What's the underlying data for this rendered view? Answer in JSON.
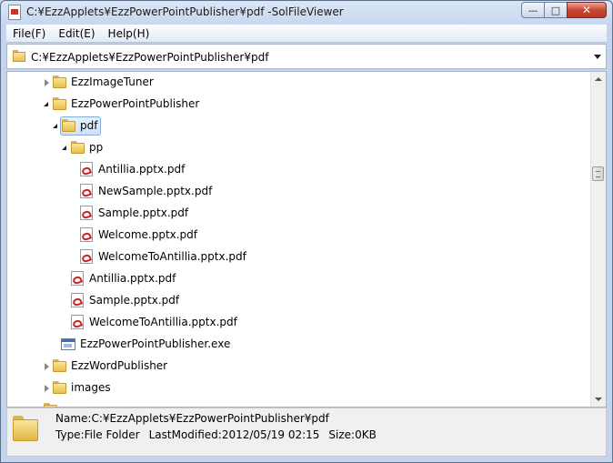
{
  "window": {
    "title": "C:¥EzzApplets¥EzzPowerPointPublisher¥pdf -SolFileViewer"
  },
  "caption_buttons": {
    "minimize": "—",
    "maximize": "□",
    "close": "✕"
  },
  "menu": {
    "file": "File(F)",
    "edit": "Edit(E)",
    "help": "Help(H)"
  },
  "path_bar": {
    "value": "C:¥EzzApplets¥EzzPowerPointPublisher¥pdf"
  },
  "tree": {
    "items": [
      {
        "label": "EzzImageTuner",
        "type": "folder",
        "state": "collapsed"
      },
      {
        "label": "EzzPowerPointPublisher",
        "type": "folder",
        "state": "expanded"
      },
      {
        "label": "pdf",
        "type": "folder",
        "state": "expanded",
        "selected": true
      },
      {
        "label": "pp",
        "type": "folder",
        "state": "expanded"
      },
      {
        "label": "Antillia.pptx.pdf",
        "type": "pdf"
      },
      {
        "label": "NewSample.pptx.pdf",
        "type": "pdf"
      },
      {
        "label": "Sample.pptx.pdf",
        "type": "pdf"
      },
      {
        "label": "Welcome.pptx.pdf",
        "type": "pdf"
      },
      {
        "label": "WelcomeToAntillia.pptx.pdf",
        "type": "pdf"
      },
      {
        "label": "Antillia.pptx.pdf",
        "type": "pdf"
      },
      {
        "label": "Sample.pptx.pdf",
        "type": "pdf"
      },
      {
        "label": "WelcomeToAntillia.pptx.pdf",
        "type": "pdf"
      },
      {
        "label": "EzzPowerPointPublisher.exe",
        "type": "exe"
      },
      {
        "label": "EzzWordPublisher",
        "type": "folder",
        "state": "collapsed"
      },
      {
        "label": "images",
        "type": "folder",
        "state": "collapsed"
      }
    ]
  },
  "status": {
    "name_label": "Name:",
    "name_value": "C:¥EzzApplets¥EzzPowerPointPublisher¥pdf",
    "type_label": "Type:",
    "type_value": "File Folder",
    "modified_label": "LastModified:",
    "modified_value": "2012/05/19 02:15",
    "size_label": "Size:",
    "size_value": "0KB"
  },
  "colors": {
    "selection_border": "#84acdd",
    "selection_fill": "#cfe1f7",
    "close_button": "#c9452f",
    "folder": "#e8bf4e",
    "pdf_mark": "#d3221f"
  }
}
